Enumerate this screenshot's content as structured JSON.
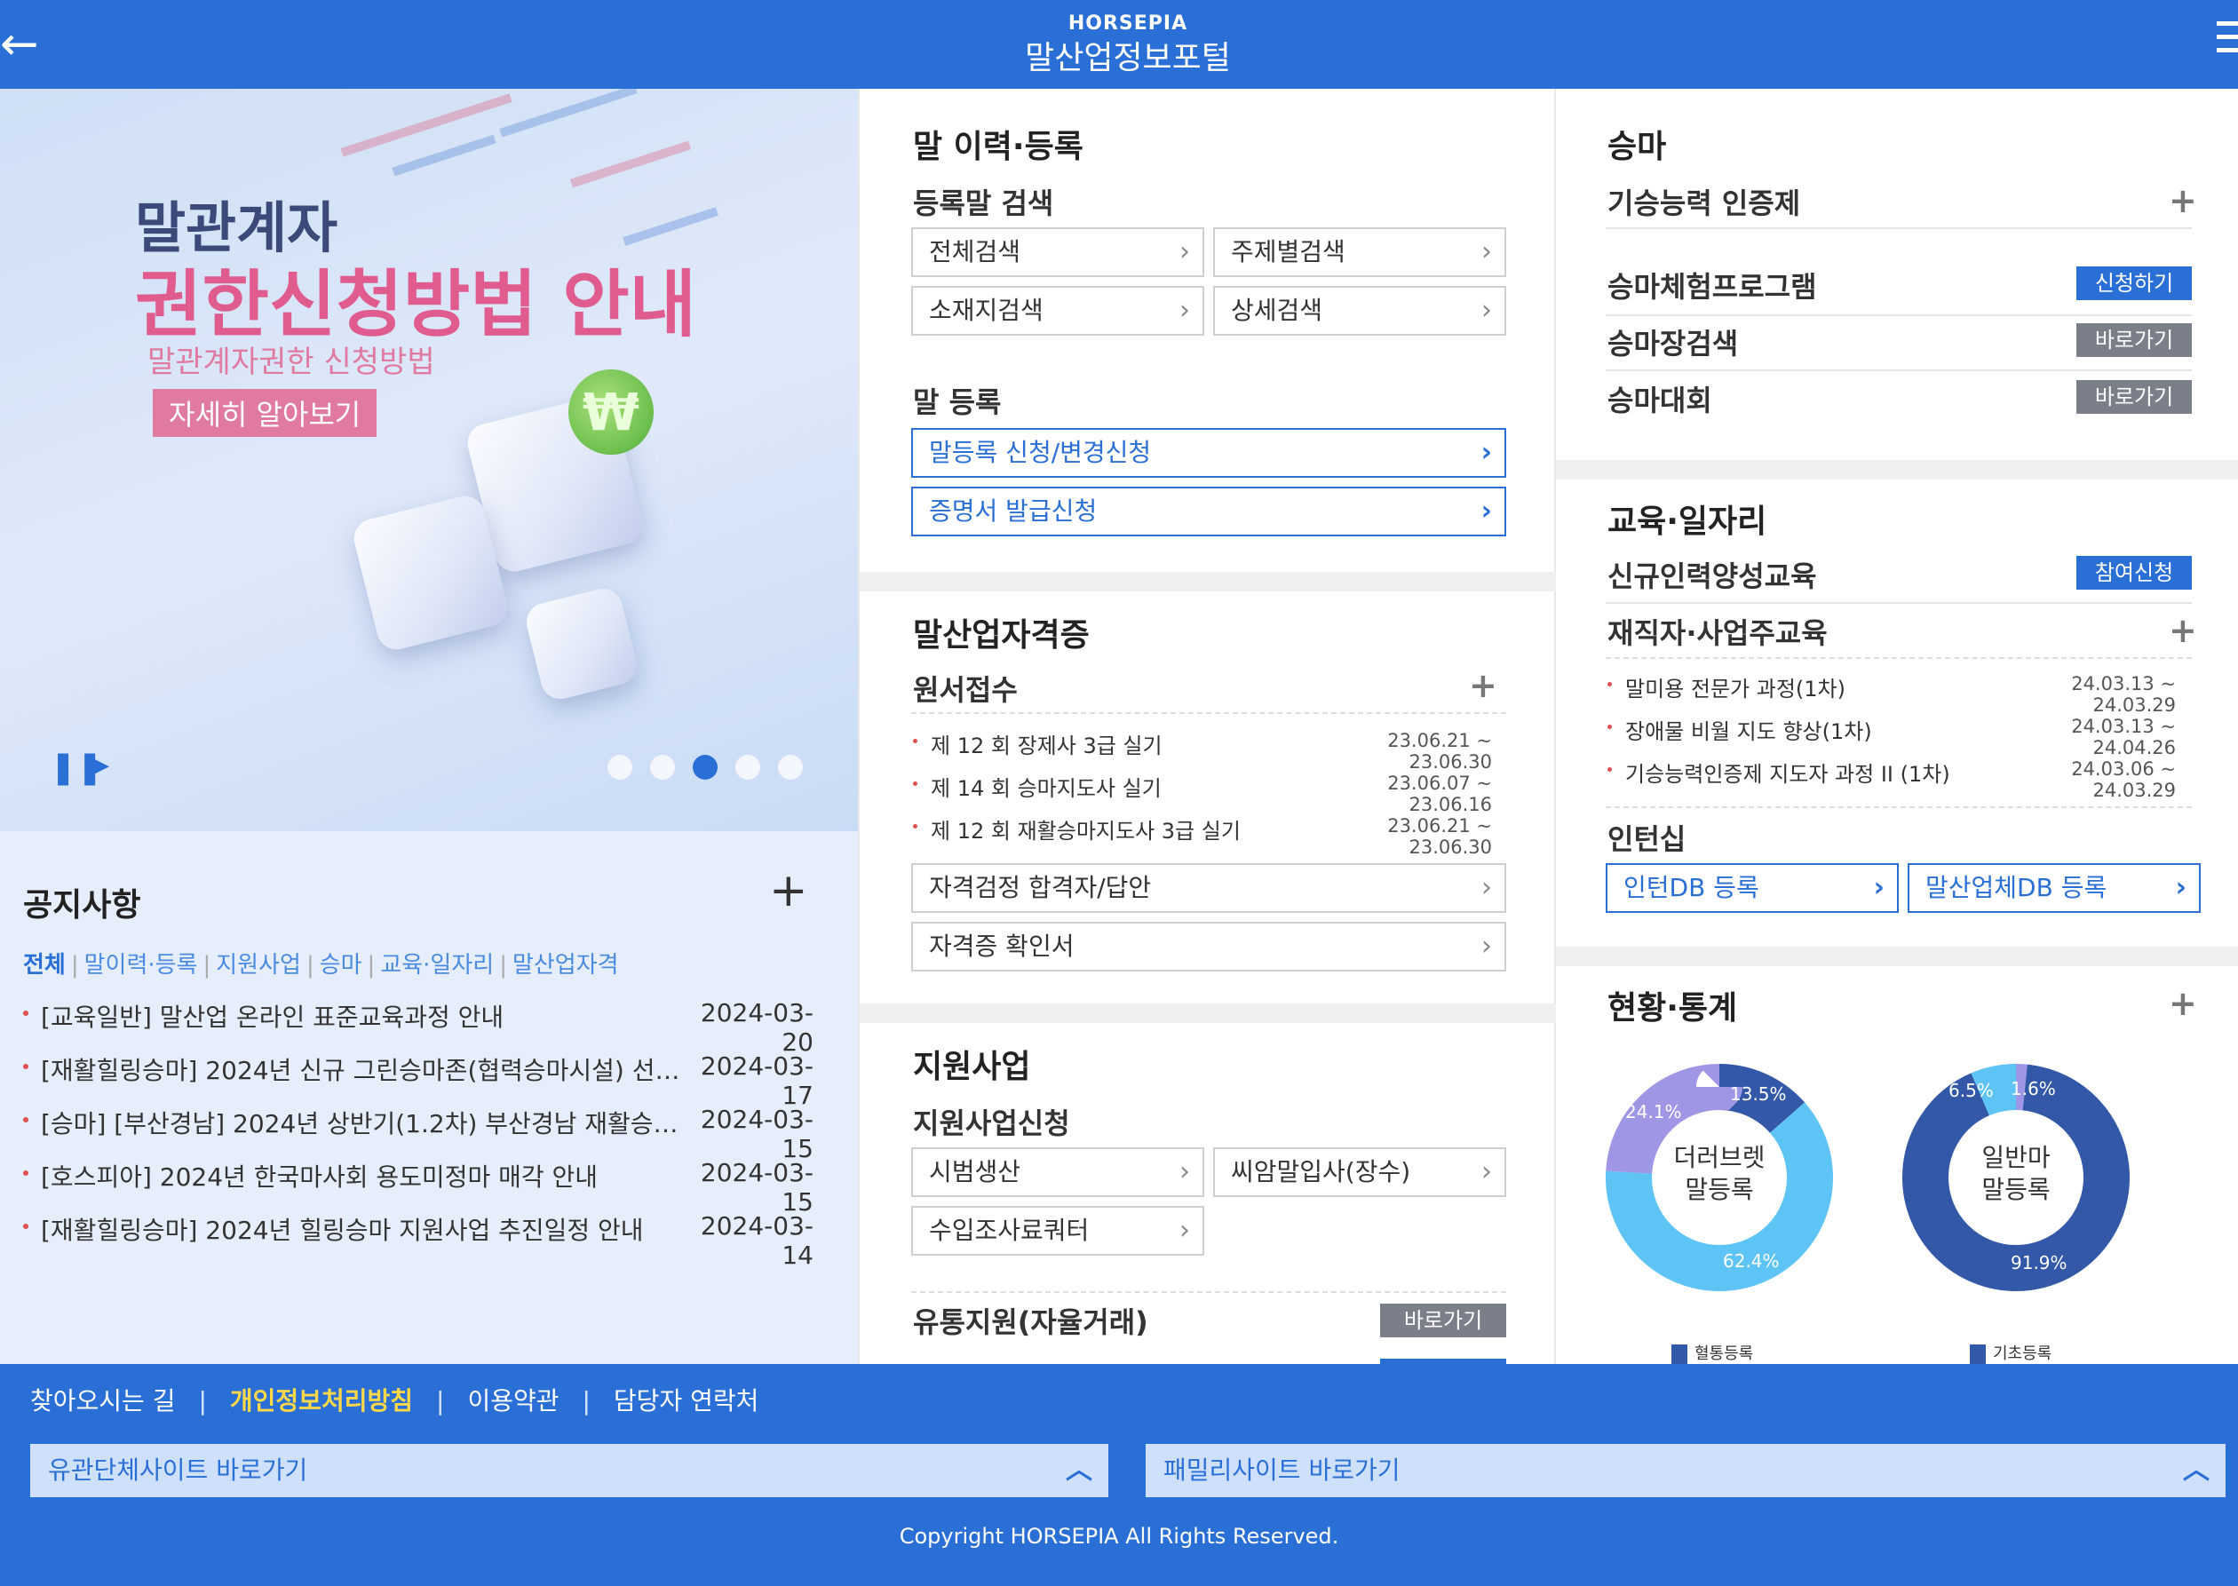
{
  "header": {
    "logo": "HORSEPIA",
    "title": "말산업정보포털"
  },
  "banner": {
    "line1": "말관계자",
    "line2": "권한신청방법 안내",
    "line3": "말관계자권한 신청방법",
    "button": "자세히 알아보기",
    "pause": "❚❚",
    "play": "▶",
    "active_slide": 3,
    "slide_count": 5
  },
  "notice": {
    "title": "공지사항",
    "plus": "+",
    "tabs": [
      "전체",
      "말이력·등록",
      "지원사업",
      "승마",
      "교육·일자리",
      "말산업자격"
    ],
    "items": [
      {
        "text": "[교육일반] 말산업 온라인 표준교육과정 안내",
        "date": "2024-03-20"
      },
      {
        "text": "[재활힐링승마] 2024년 신규 그린승마존(협력승마시설) 선정 …",
        "date": "2024-03-17"
      },
      {
        "text": "[승마] [부산경남] 2024년 상반기(1.2차) 부산경남 재활승마 강…",
        "date": "2024-03-15"
      },
      {
        "text": "[호스피아] 2024년 한국마사회 용도미정마 매각 안내",
        "date": "2024-03-15"
      },
      {
        "text": "[재활힐링승마] 2024년 힐링승마 지원사업 추진일정 안내",
        "date": "2024-03-14"
      }
    ]
  },
  "mid": {
    "s1_title": "말 이력·등록",
    "s1_sub1": "등록말 검색",
    "search_btns": [
      "전체검색",
      "주제별검색",
      "소재지검색",
      "상세검색"
    ],
    "s1_sub2": "말 등록",
    "reg_btns": [
      "말등록 신청/변경신청",
      "증명서 발급신청"
    ],
    "s2_title": "말산업자격증",
    "s2_sub1": "원서접수",
    "exams": [
      {
        "text": "제 12 회 장제사 3급 실기",
        "date": "23.06.21 ~ 23.06.30"
      },
      {
        "text": "제 14 회 승마지도사 실기",
        "date": "23.06.07 ~ 23.06.16"
      },
      {
        "text": "제 12 회 재활승마지도사 3급 실기",
        "date": "23.06.21 ~ 23.06.30"
      }
    ],
    "cert_btns": [
      "자격검정 합격자/답안",
      "자격증 확인서"
    ],
    "s3_title": "지원사업",
    "s3_sub1": "지원사업신청",
    "support_btns": [
      "시범생산",
      "씨암말입사(장수)",
      "수입조사료쿼터"
    ],
    "s3_sub2": "유통지원(자율거래)",
    "s3_sub2_tag": "바로가기"
  },
  "right": {
    "r1_title": "승마",
    "r1_sub1": "기승능력 인증제",
    "riding_rows": [
      {
        "label": "승마체험프로그램",
        "tag": "신청하기"
      },
      {
        "label": "승마장검색",
        "tag": "바로가기"
      },
      {
        "label": "승마대회",
        "tag": "바로가기"
      }
    ],
    "r2_title": "교육·일자리",
    "r2_row1": "신규인력양성교육",
    "r2_row1_tag": "참여신청",
    "r2_row2": "재직자·사업주교육",
    "edu_items": [
      {
        "text": "말미용 전문가 과정(1차)",
        "date": "24.03.13 ~ 24.03.29"
      },
      {
        "text": "장애물 비월 지도 향상(1차)",
        "date": "24.03.13 ~ 24.04.26"
      },
      {
        "text": "기승능력인증제 지도자 과정 II (1차)",
        "date": "24.03.06 ~ 24.03.29"
      }
    ],
    "r2_sub3": "인턴십",
    "intern_btns": [
      "인턴DB 등록",
      "말산업체DB 등록"
    ],
    "r3_title": "현황·통계",
    "donut1": {
      "center1": "더러브렛",
      "center2": "말등록",
      "labels": [
        "13.5%",
        "62.4%",
        "24.1%"
      ],
      "values": [
        13.5,
        62.4,
        24.1
      ],
      "colors": [
        "#3358a8",
        "#5ec3f5",
        "#9f97e6"
      ],
      "legend": "혈통등록"
    },
    "donut2": {
      "center1": "일반마",
      "center2": "말등록",
      "labels": [
        "1.6%",
        "91.9%",
        "6.5%"
      ],
      "values": [
        1.6,
        91.9,
        6.5
      ],
      "colors": [
        "#9f97e6",
        "#3358a8",
        "#5ec3f5"
      ],
      "legend": "기초등록"
    }
  },
  "footer": {
    "links": [
      "찾아오시는 길",
      "개인정보처리방침",
      "이용약관",
      "담당자 연락처"
    ],
    "site1": "유관단체사이트 바로가기",
    "site2": "패밀리사이트 바로가기",
    "copyright": "Copyright HORSEPIA All Rights Reserved."
  }
}
